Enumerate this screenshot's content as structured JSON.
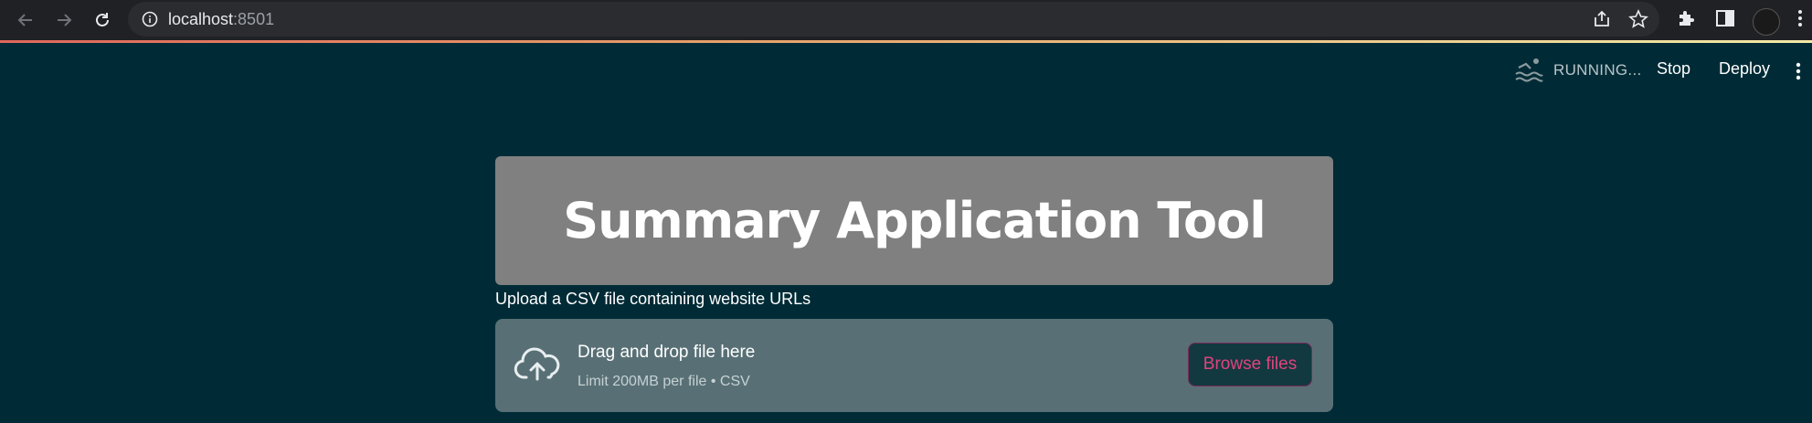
{
  "browser": {
    "url_host": "localhost",
    "url_port": ":8501"
  },
  "header": {
    "status_text": "RUNNING...",
    "stop_label": "Stop",
    "deploy_label": "Deploy"
  },
  "main": {
    "title": "Summary Application Tool",
    "upload_label": "Upload a CSV file containing website URLs",
    "dropzone": {
      "title": "Drag and drop file here",
      "subtitle": "Limit 200MB per file • CSV",
      "button_label": "Browse files"
    }
  },
  "colors": {
    "background": "#002b36",
    "title_box": "#808080",
    "dropzone": "#587075",
    "accent": "#e0437f"
  },
  "icons": [
    "back-arrow-icon",
    "forward-arrow-icon",
    "reload-icon",
    "info-icon",
    "share-icon",
    "star-icon",
    "puzzle-icon",
    "sidepanel-icon",
    "swimmer-icon",
    "kebab-icon",
    "cloud-upload-icon"
  ]
}
